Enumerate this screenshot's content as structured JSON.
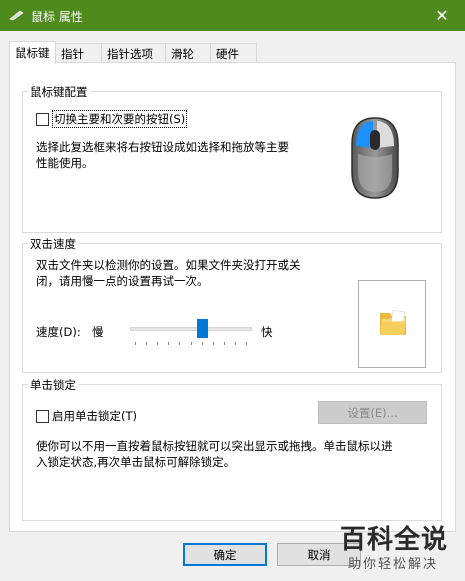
{
  "window": {
    "title": "鼠标 属性",
    "close_glyph": "✕"
  },
  "tabs": [
    {
      "label": "鼠标键"
    },
    {
      "label": "指针"
    },
    {
      "label": "指针选项"
    },
    {
      "label": "滑轮"
    },
    {
      "label": "硬件"
    }
  ],
  "button_config": {
    "title": "鼠标键配置",
    "switch_label": "切换主要和次要的按钮(S)",
    "switch_checked": false,
    "desc_line1": "选择此复选框来将右按钮设成如选择和拖放等主要",
    "desc_line2": "性能使用。"
  },
  "double_click": {
    "title": "双击速度",
    "desc_line1": "双击文件夹以检测你的设置。如果文件夹没打开或关",
    "desc_line2": "闭，请用慢一点的设置再试一次。",
    "speed_label": "速度(D):",
    "slow_label": "慢",
    "fast_label": "快",
    "speed_value": 0.6
  },
  "click_lock": {
    "title": "单击锁定",
    "enable_label": "启用单击锁定(T)",
    "enable_checked": false,
    "settings_label": "设置(E)...",
    "desc_line1": "使你可以不用一直按着鼠标按钮就可以突出显示或拖拽。单击鼠标以进",
    "desc_line2": "入锁定状态,再次单击鼠标可解除锁定。"
  },
  "footer": {
    "ok_label": "确定",
    "cancel_label": "取消"
  },
  "watermark": {
    "line1": "百科全说",
    "line2": "助你轻松解决"
  },
  "colors": {
    "titlebar": "#4e8a1c",
    "accent": "#0078d7"
  }
}
